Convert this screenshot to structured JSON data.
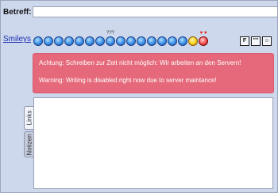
{
  "subject": {
    "label": "Betreff:",
    "value": ""
  },
  "smileys": {
    "label": "Smileys",
    "items": [
      {
        "name": "smile-icon",
        "glyph": "",
        "color": "blue"
      },
      {
        "name": "grin-icon",
        "glyph": "",
        "color": "blue"
      },
      {
        "name": "laugh-icon",
        "glyph": "",
        "color": "blue"
      },
      {
        "name": "headphones-icon",
        "glyph": "",
        "color": "blue"
      },
      {
        "name": "sad-icon",
        "glyph": "",
        "color": "blue"
      },
      {
        "name": "tongue-icon",
        "glyph": "",
        "color": "blue"
      },
      {
        "name": "sunglasses-icon",
        "glyph": "",
        "color": "blue"
      },
      {
        "name": "confused-icon",
        "glyph": "",
        "color": "blue",
        "top": "???"
      },
      {
        "name": "angry-icon",
        "glyph": "",
        "color": "blue"
      },
      {
        "name": "wink-icon",
        "glyph": "",
        "color": "blue"
      },
      {
        "name": "surprised-icon",
        "glyph": "",
        "color": "blue"
      },
      {
        "name": "neutral-icon",
        "glyph": "",
        "color": "blue"
      },
      {
        "name": "cool-icon",
        "glyph": "",
        "color": "blue"
      },
      {
        "name": "blush-icon",
        "glyph": "",
        "color": "blue"
      },
      {
        "name": "tired-icon",
        "glyph": "",
        "color": "blue"
      },
      {
        "name": "yellow-smiley-icon",
        "glyph": "",
        "color": "yellow"
      },
      {
        "name": "love-smiley-icon",
        "glyph": "",
        "color": "red",
        "top": "♥ ♥"
      }
    ]
  },
  "format_buttons": [
    {
      "name": "format-f-button",
      "label": "F"
    },
    {
      "name": "format-quote-button",
      "label": "\"\""
    },
    {
      "name": "format-emoji-button",
      "label": "☺"
    }
  ],
  "alert": {
    "de": "Achtung: Schreiben zur Zeit nicht möglich: Wir arbeiten an den Servern!",
    "en": "Warning: Writing is disabled right now due to server maintance!"
  },
  "tabs": {
    "links": "Links",
    "notes": "Notizen"
  },
  "colors": {
    "background": "#ced8ec",
    "alert": "#e5697a",
    "link": "#1a2fb0"
  }
}
